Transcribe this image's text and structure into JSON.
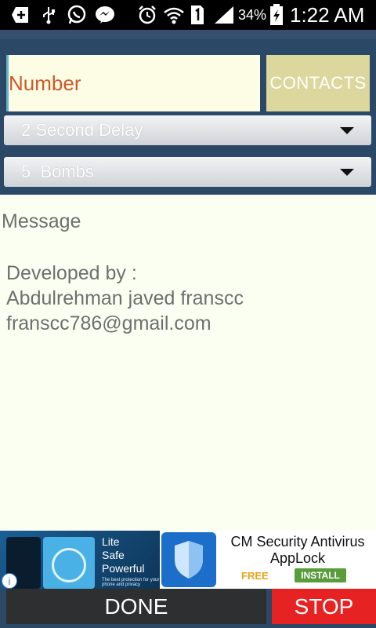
{
  "status_bar": {
    "battery_percent": "34%",
    "time": "1:22 AM",
    "icons": [
      "add-box-icon",
      "usb-icon",
      "whatsapp-icon",
      "messenger-icon",
      "alarm-icon",
      "wifi-icon",
      "sim-1-icon",
      "signal-icon",
      "battery-charging-icon"
    ]
  },
  "number_input": {
    "placeholder": "Number",
    "value": ""
  },
  "contacts_button": {
    "label": "CONTACTS"
  },
  "delay_spinner": {
    "selected": "2 Second Delay"
  },
  "bombs_spinner": {
    "selected": "5  Bombs"
  },
  "message": {
    "label": "Message",
    "line1": "Developed by :",
    "line2": "Abdulrehman javed franscc",
    "line3": "franscc786@gmail.com"
  },
  "ad": {
    "tagline1": "Lite",
    "tagline2": "Safe",
    "tagline3": "Powerful",
    "image_caption": "The best protection for your phone and privacy",
    "app_title": "CM Security Antivirus AppLock",
    "price": "FREE",
    "install_label": "INSTALL"
  },
  "actions": {
    "done_label": "DONE",
    "stop_label": "STOP"
  },
  "colors": {
    "background": "#2a4564",
    "number_text": "#cc5a2b",
    "contacts_bg": "#dcd79c",
    "message_bg": "#fbfff2",
    "done_bg": "#2d2f30",
    "stop_bg": "#e62222"
  }
}
